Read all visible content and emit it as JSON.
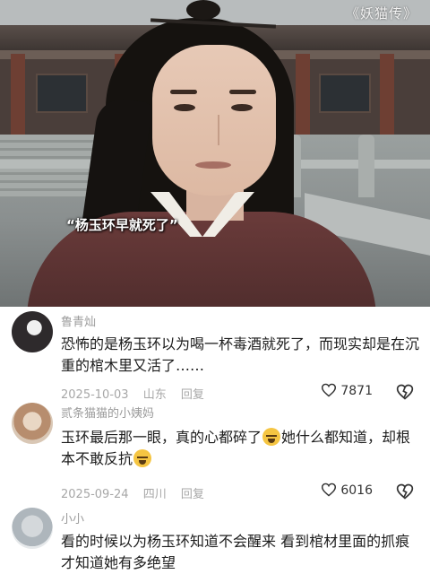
{
  "video": {
    "watermark": "《妖猫传》",
    "subtitle": "“杨玉环早就死了”"
  },
  "comments": [
    {
      "username": "鲁青灿",
      "text": "恐怖的是杨玉环以为喝一杯毒酒就死了，而现实却是在沉重的棺木里又活了……",
      "date": "2025-10-03",
      "location": "山东",
      "reply_label": "回复",
      "likes": "7871",
      "avatar": "avatar-dark-portrait"
    },
    {
      "username": "贰条猫猫的小姨妈",
      "text_part1": "玉环最后那一眼，真的心都碎了",
      "text_part2": "她什么都知道，却根本不敢反抗",
      "emoji": "crying-face-icon",
      "date": "2025-09-24",
      "location": "四川",
      "reply_label": "回复",
      "likes": "6016",
      "avatar": "avatar-cat"
    },
    {
      "username": "小小",
      "text": "看的时候以为杨玉环知道不会醒来 看到棺材里面的抓痕才知道她有多绝望",
      "avatar": "avatar-seal"
    }
  ],
  "colors": {
    "text": "#1c1c1c",
    "secondary": "#9b9b9b",
    "robe": "#5a3333"
  }
}
